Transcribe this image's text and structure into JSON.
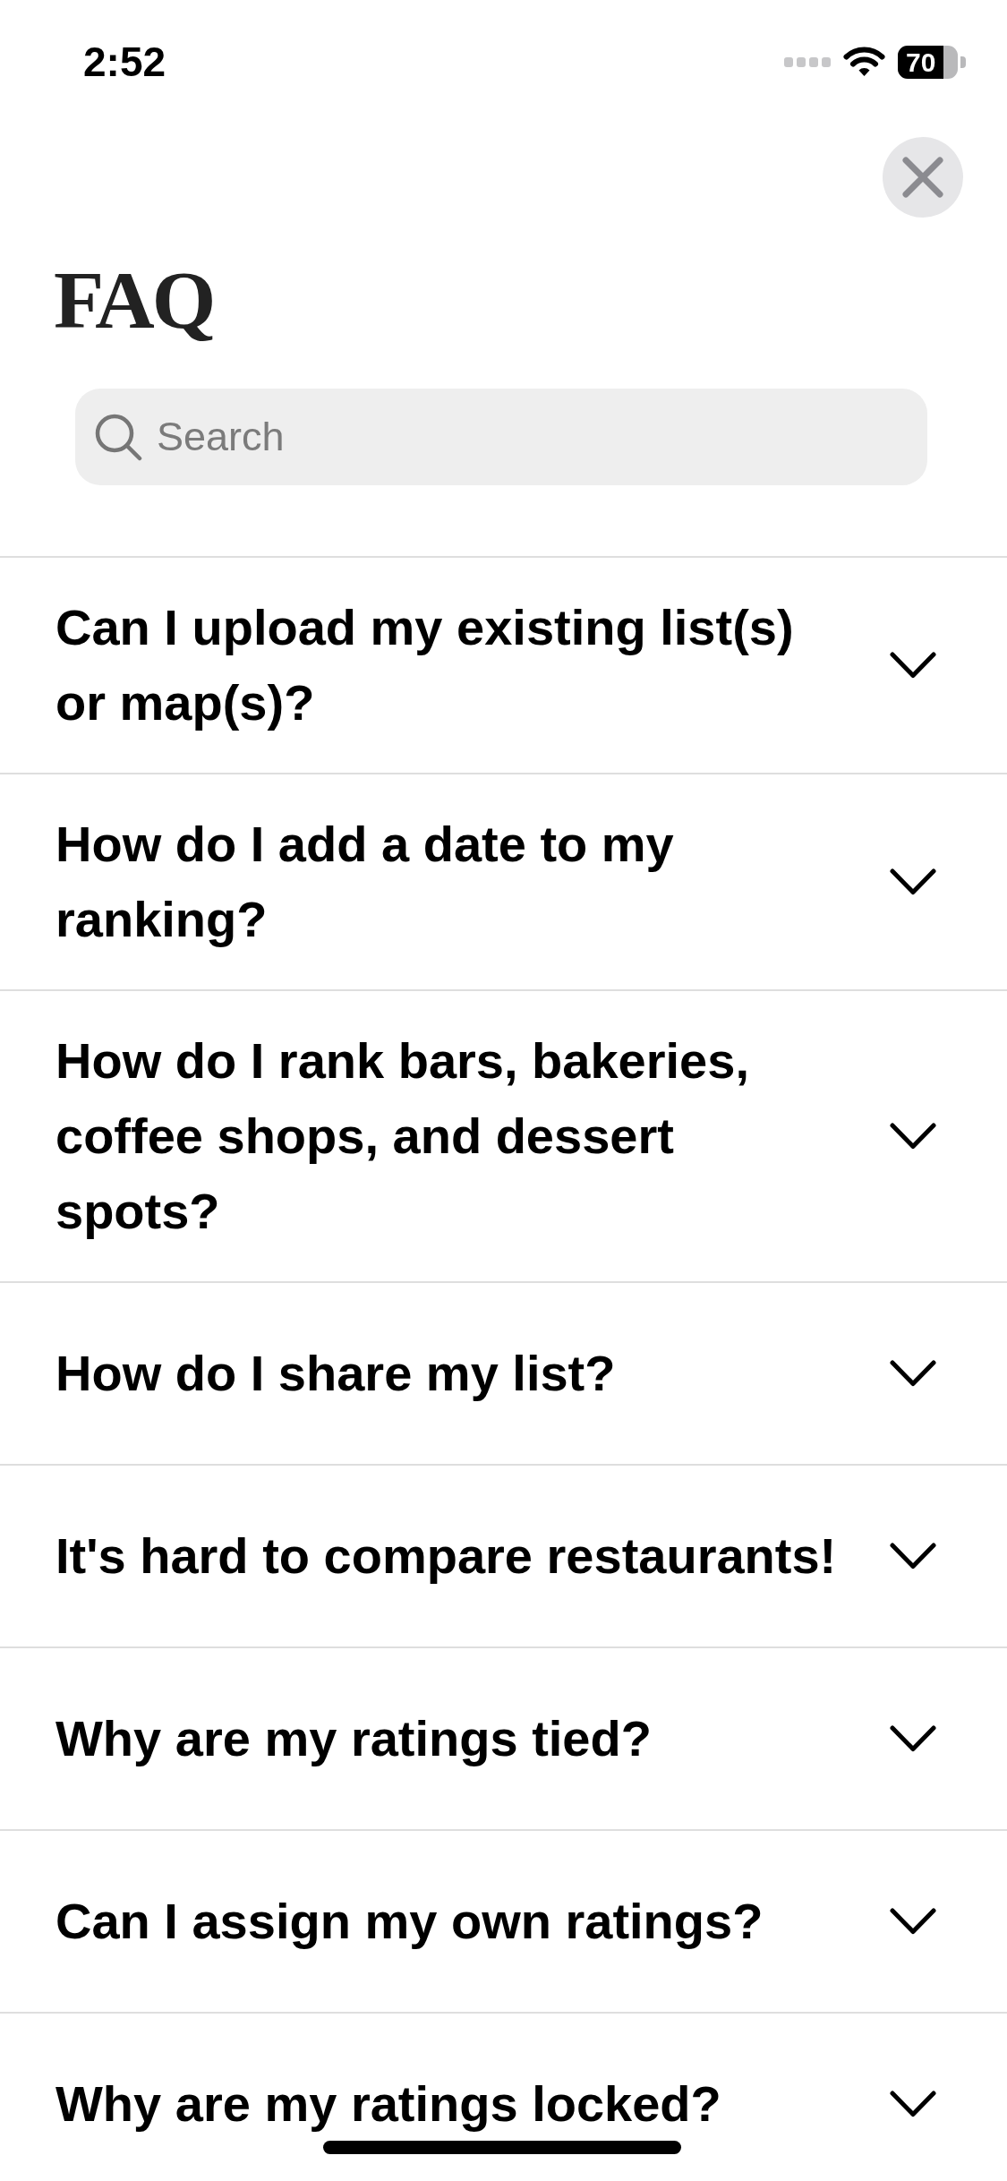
{
  "status_bar": {
    "time": "2:52",
    "battery": "70"
  },
  "title": "FAQ",
  "search": {
    "placeholder": "Search"
  },
  "faq": {
    "items": [
      {
        "question": "Can I upload my existing list(s) or map(s)?",
        "expanded": false
      },
      {
        "question": "How do I add a date to my ranking?",
        "expanded": false
      },
      {
        "question": "How do I rank bars, bakeries, coffee shops, and dessert spots?",
        "expanded": false
      },
      {
        "question": "How do I share my list?",
        "expanded": false
      },
      {
        "question": "It's hard to compare restaurants!",
        "expanded": false
      },
      {
        "question": "Why are my ratings tied?",
        "expanded": false
      },
      {
        "question": "Can I assign my own ratings?",
        "expanded": false
      },
      {
        "question": "Why are my ratings locked?",
        "expanded": false
      }
    ]
  }
}
